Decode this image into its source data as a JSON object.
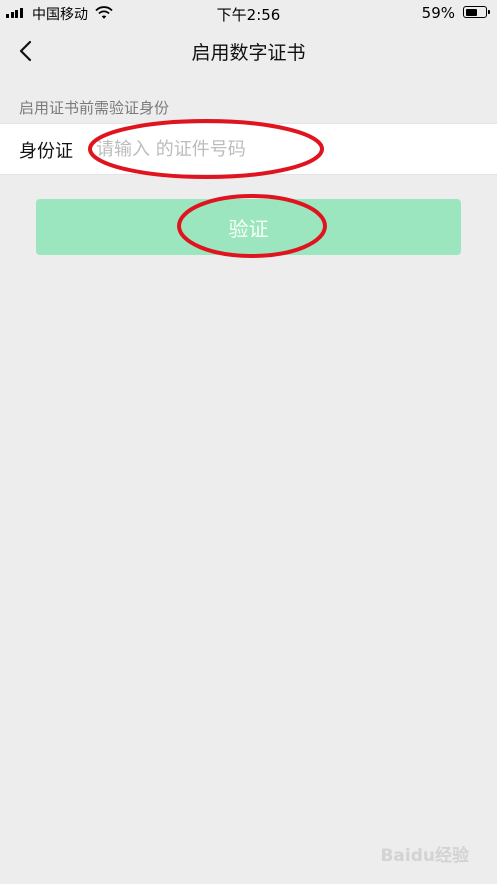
{
  "status_bar": {
    "carrier": "中国移动",
    "time": "下午2:56",
    "battery_percent": "59%",
    "battery_level": 0.59,
    "signal_icon": "signal-bars-icon",
    "wifi_icon": "wifi-icon",
    "battery_icon": "battery-icon"
  },
  "nav": {
    "title": "启用数字证书",
    "back_icon": "chevron-left-icon"
  },
  "form": {
    "hint": "启用证书前需验证身份",
    "id_label": "身份证",
    "id_placeholder": "请输入 的证件号码",
    "id_value": "",
    "verify_label": "验证"
  },
  "annotations": {
    "color": "#e0141e"
  },
  "watermark": {
    "text": "Baidu经验"
  },
  "colors": {
    "background": "#ededed",
    "verify_button": "#9ce6bf"
  }
}
